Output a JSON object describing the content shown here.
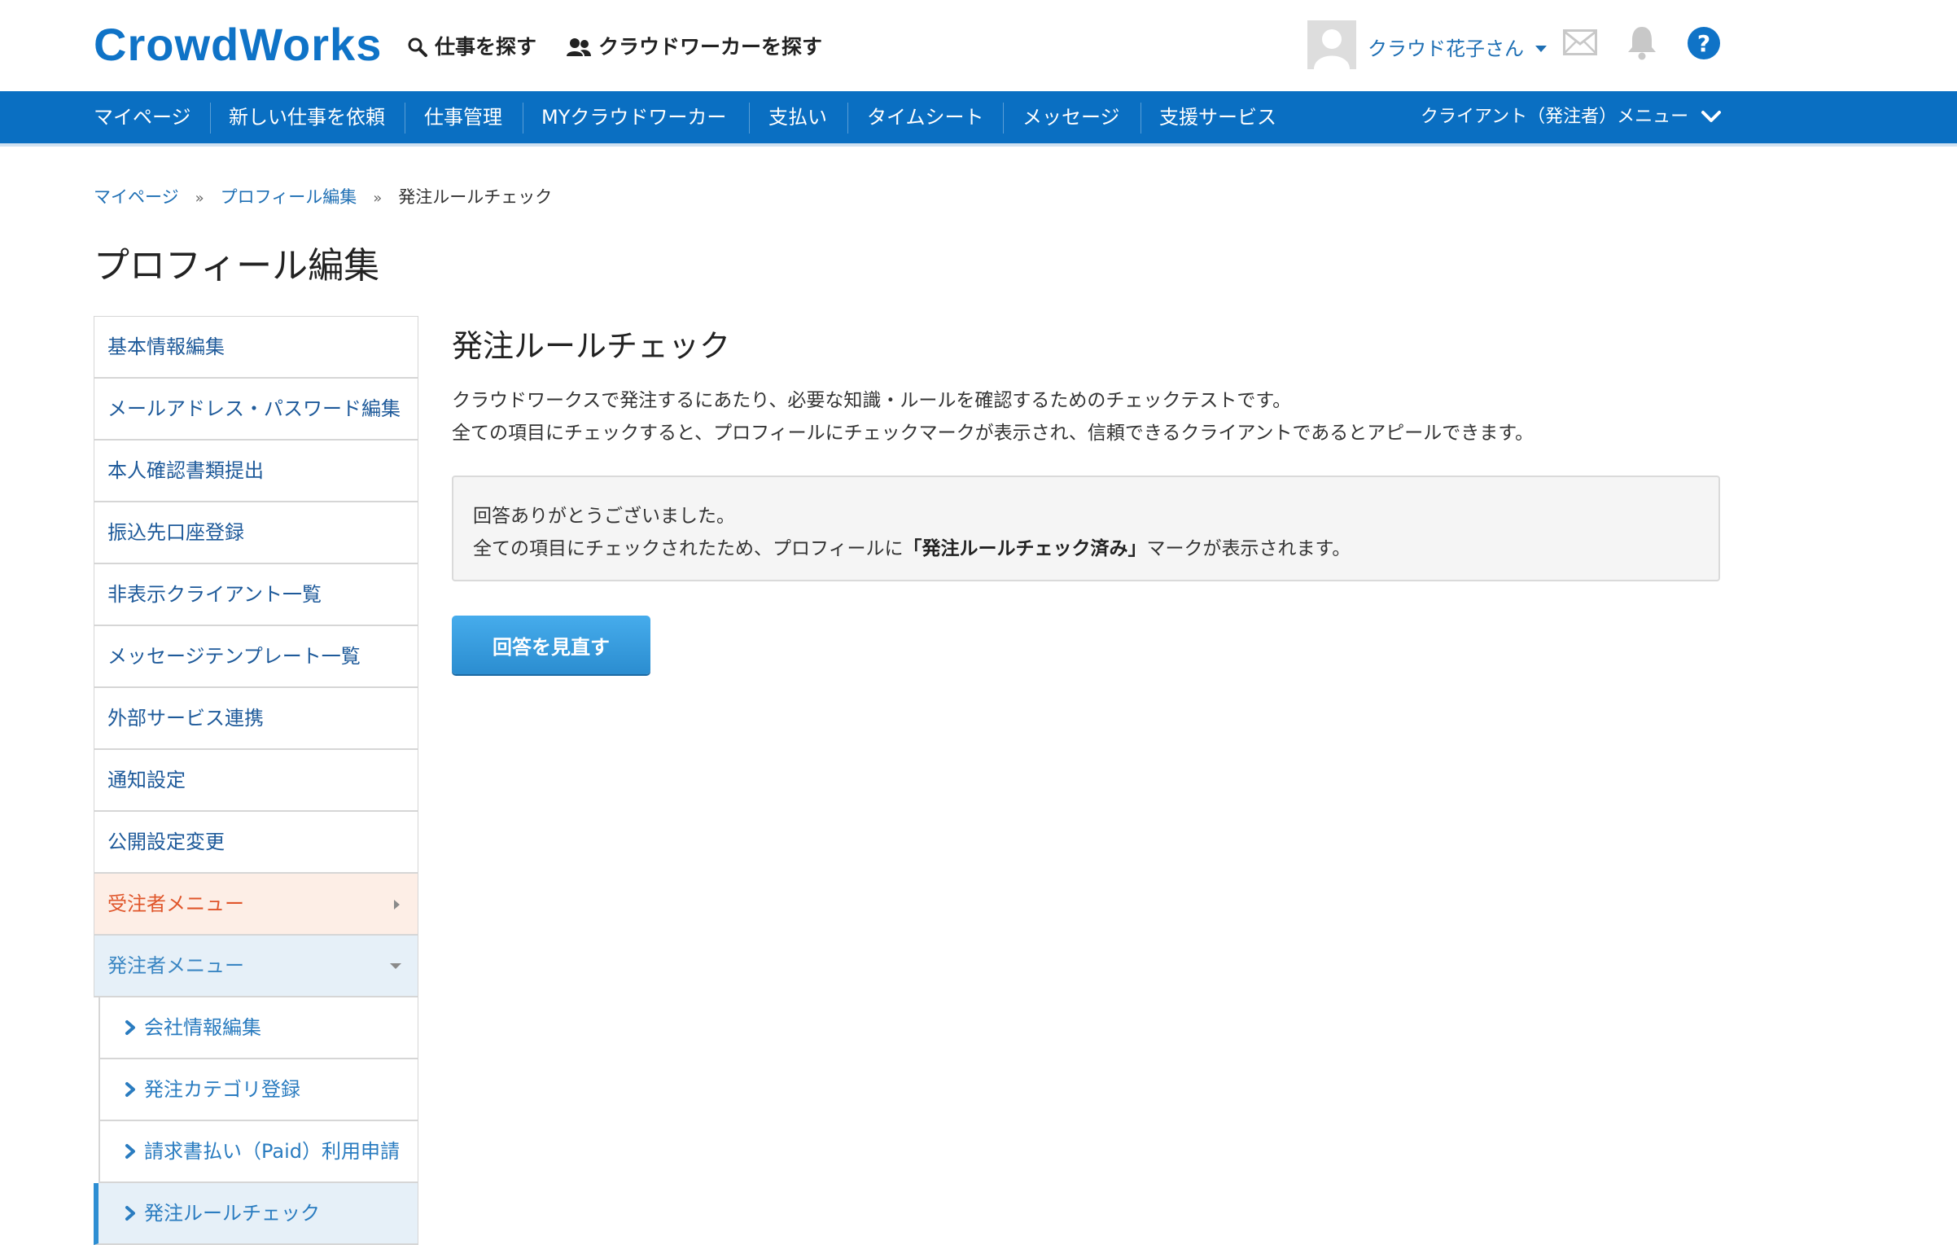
{
  "header": {
    "logo": "CrowdWorks",
    "links": [
      "仕事を探す",
      "クラウドワーカーを探す"
    ],
    "user_name": "クラウド花子さん",
    "icons": [
      "search-icon",
      "people-icon",
      "mail-icon",
      "bell-icon",
      "help-icon"
    ]
  },
  "nav": {
    "items": [
      "マイページ",
      "新しい仕事を依頼",
      "仕事管理",
      "MYクラウドワーカー",
      "支払い",
      "タイムシート",
      "メッセージ",
      "支援サービス"
    ],
    "client_menu": "クライアント（発注者）メニュー"
  },
  "breadcrumb": [
    "マイページ",
    "プロフィール編集",
    "発注ルールチェック"
  ],
  "breadcrumb_separator": "»",
  "page_title": "プロフィール編集",
  "sidebar": {
    "items": [
      "基本情報編集",
      "メールアドレス・パスワード編集",
      "本人確認書類提出",
      "振込先口座登録",
      "非表示クライアント一覧",
      "メッセージテンプレート一覧",
      "外部サービス連携",
      "通知設定",
      "公開設定変更"
    ],
    "worker_menu": "受注者メニュー",
    "client_menu": "発注者メニュー",
    "client_sub": [
      "会社情報編集",
      "発注カテゴリ登録",
      "請求書払い（Paid）利用申請",
      "発注ルールチェック"
    ]
  },
  "content": {
    "title": "発注ルールチェック",
    "desc_line1": "クラウドワークスで発注するにあたり、必要な知識・ルールを確認するためのチェックテストです。",
    "desc_line2": "全ての項目にチェックすると、プロフィールにチェックマークが表示され、信頼できるクライアントであるとアピールできます。",
    "notice_line1": "回答ありがとうございました。",
    "notice_line2_pre": "全ての項目にチェックされたため、プロフィールに",
    "notice_line2_bold": "「発注ルールチェック済み」",
    "notice_line2_post": "マークが表示されます。",
    "button": "回答を見直す"
  },
  "colors": {
    "brand": "#0f73c7",
    "nav_bg": "#0a6fc2",
    "button": "#2b8dd0",
    "worker_accent": "#e0562b"
  }
}
